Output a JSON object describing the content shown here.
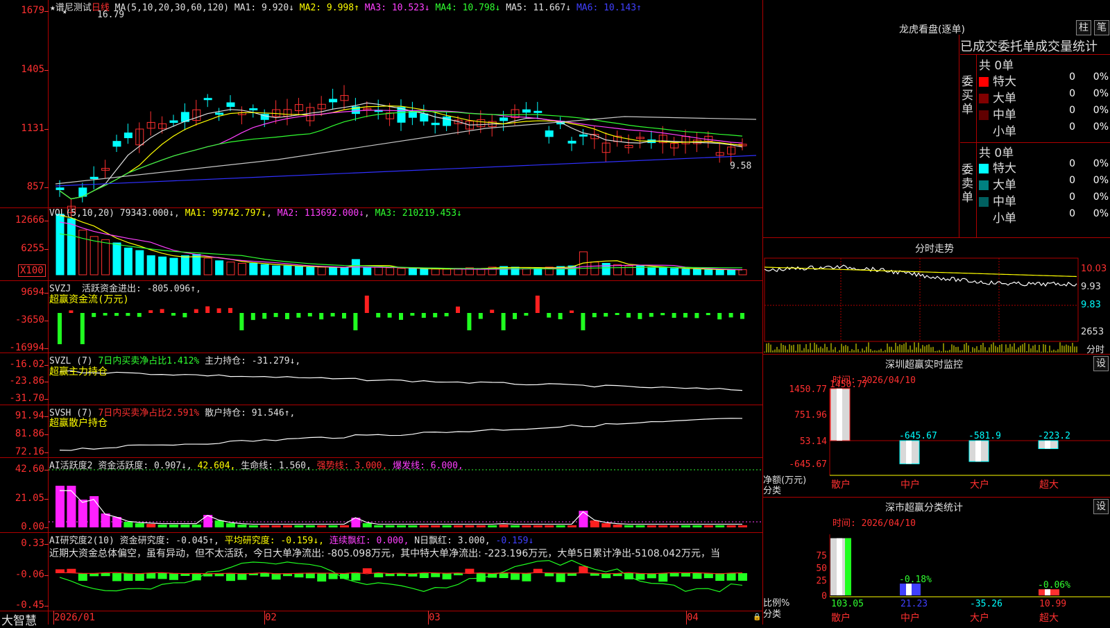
{
  "price": {
    "title": "★谱尼测试",
    "period": "日线",
    "ma_params": "MA(5,10,20,30,60,120)",
    "ma": [
      {
        "name": "MA1:",
        "value": "9.920↓",
        "color": "#e0e0e0"
      },
      {
        "name": "MA2:",
        "value": "9.998↑",
        "color": "#ffff00"
      },
      {
        "name": "MA3:",
        "value": "10.523↓",
        "color": "#ff40ff"
      },
      {
        "name": "MA4:",
        "value": "10.798↓",
        "color": "#30ff30"
      },
      {
        "name": "MA5:",
        "value": "11.667↓",
        "color": "#e0e0e0"
      },
      {
        "name": "MA6:",
        "value": "10.143↑",
        "color": "#4040ff"
      }
    ],
    "axis": [
      "1679",
      "1405",
      "1131",
      "857"
    ],
    "high_mark": "16.79",
    "low_mark": "9.58",
    "star": "★"
  },
  "vol": {
    "header": "VOL(5,10,20)",
    "value": "79343.000↓",
    "ma1": "MA1: 99742.797↓",
    "ma2": "MA2: 113692.000↓",
    "ma3": "MA3: 210219.453↓",
    "axis": [
      "12666",
      "6255"
    ],
    "unit": "X100"
  },
  "svzj": {
    "name": "SVZJ",
    "line1": "活跃资金进出: -805.096↑",
    "line2": "超赢资金流(万元)",
    "axis": [
      "9694",
      "-3650",
      "-16994"
    ]
  },
  "svzl": {
    "name": "SVZL (7)",
    "line1": "7日内买卖净占比1.412%",
    "line1b": "主力持仓: -31.279↓,",
    "line2": "超赢主力持仓",
    "axis": [
      "-16.02",
      "-23.86",
      "-31.70"
    ]
  },
  "svsh": {
    "name": "SVSH (7)",
    "line1": "7日内买卖净占比2.591%",
    "line1b": "散户持仓: 91.546↑,",
    "line2": "超赢散户持仓",
    "axis": [
      "91.94",
      "81.86",
      "72.16"
    ]
  },
  "ai1": {
    "name": "AI活跃度2",
    "parts": [
      {
        "t": "资金活跃度: 0.907↓,",
        "c": "#e0e0e0"
      },
      {
        "t": "42.604,",
        "c": "#ffff00"
      },
      {
        "t": "生命线: 1.560,",
        "c": "#e0e0e0"
      },
      {
        "t": "强势线: 3.000,",
        "c": "#ff3030"
      },
      {
        "t": "爆发线: 6.000,",
        "c": "#ff40ff"
      }
    ],
    "axis": [
      "42.60",
      "21.05",
      "0.00"
    ]
  },
  "ai2": {
    "name": "AI研究度2(10)",
    "parts": [
      {
        "t": "资金研究度: -0.045↑,",
        "c": "#e0e0e0"
      },
      {
        "t": "平均研究度: -0.159↓,",
        "c": "#ffff00"
      },
      {
        "t": "连续飘红: 0.000,",
        "c": "#ff40ff"
      },
      {
        "t": "N日飘红: 3.000,",
        "c": "#e0e0e0"
      },
      {
        "t": "-0.159↓",
        "c": "#4040ff"
      }
    ],
    "comment": "近期大资金总体偏空，虽有异动，但不太活跃，今日大单净流出: -805.098万元，其中特大单净流出: -223.196万元，大单5日累计净出-5108.042万元，当",
    "axis": [
      "0.33",
      "-0.06",
      "-0.45"
    ]
  },
  "xaxis": {
    "brand": "大智慧",
    "labels": [
      "2026/01",
      "02",
      "03",
      "04"
    ]
  },
  "dragon": {
    "title": "龙虎看盘(逐单)",
    "btn1": "柱",
    "btn2": "笔",
    "tabs": "已成交委托单成交量统计",
    "buy_label": "委买单",
    "sell_label": "委卖单",
    "buy_total": "共 0单",
    "sell_total": "共 0单",
    "buy_rows": [
      {
        "name": "特大",
        "count": "0",
        "pct": "0%",
        "color": "#ff0000"
      },
      {
        "name": "大单",
        "count": "0",
        "pct": "0%",
        "color": "#800000"
      },
      {
        "name": "中单",
        "count": "0",
        "pct": "0%",
        "color": "#600000"
      },
      {
        "name": "小单",
        "count": "0",
        "pct": "0%",
        "color": "#000000"
      }
    ],
    "sell_rows": [
      {
        "name": "特大",
        "count": "0",
        "pct": "0%",
        "color": "#00ffff"
      },
      {
        "name": "大单",
        "count": "0",
        "pct": "0%",
        "color": "#008080"
      },
      {
        "name": "中单",
        "count": "0",
        "pct": "0%",
        "color": "#006060"
      },
      {
        "name": "小单",
        "count": "0",
        "pct": "0%",
        "color": "#000000"
      }
    ]
  },
  "intraday": {
    "title": "分时走势",
    "axis": [
      "10.03",
      "9.93",
      "9.83",
      "2653"
    ],
    "unit": "分时"
  },
  "monitor": {
    "title": "深圳超赢实时监控",
    "btn": "设",
    "time": "时间: 2026/04/10",
    "axis": [
      "1450.77",
      "751.96",
      "53.14",
      "-645.67"
    ],
    "ylabel1": "净额(万元)",
    "ylabel2": "分类",
    "bars": [
      {
        "cat": "散户",
        "value": 1450.77,
        "label": "1450.77",
        "label_color": "#ff3030"
      },
      {
        "cat": "中户",
        "value": -645.67,
        "label": "-645.67",
        "label_color": "#00ffff"
      },
      {
        "cat": "大户",
        "value": -581.9,
        "label": "-581.9",
        "label_color": "#00ffff"
      },
      {
        "cat": "超大",
        "value": -223.2,
        "label": "-223.2",
        "label_color": "#00ffff"
      }
    ]
  },
  "classify": {
    "title": "深市超赢分类统计",
    "btn": "设",
    "time": "时间: 2026/04/10",
    "axis": [
      "75",
      "50",
      "25",
      "0"
    ],
    "ylabel1": "比例%",
    "ylabel2": "分类",
    "bars": [
      {
        "cat": "散户",
        "value": 103.05,
        "label": "103.05",
        "label_color": "#30ff30",
        "top_label": ""
      },
      {
        "cat": "中户",
        "value": 21.23,
        "label": "21.23",
        "label_color": "#4040ff",
        "top_label": "-0.18%"
      },
      {
        "cat": "大户",
        "value": -35.26,
        "label": "-35.26",
        "label_color": "#00ffff",
        "top_label": ""
      },
      {
        "cat": "超大",
        "value": 10.99,
        "label": "10.99",
        "label_color": "#ff3030",
        "top_label": "-0.06%"
      }
    ]
  }
}
